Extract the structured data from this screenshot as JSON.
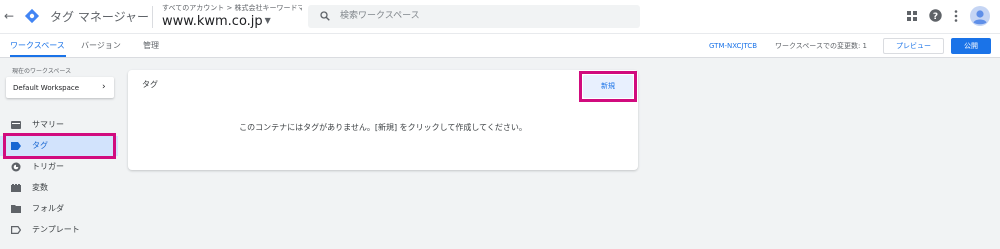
{
  "header": {
    "app_title": "タグ マネージャー",
    "breadcrumb": "すべてのアカウント > 株式会社キーワードマ...",
    "container_name": "www.kwm.co.jp",
    "search_placeholder": "検索ワークスペース"
  },
  "nav": {
    "tabs": [
      {
        "label": "ワークスペース",
        "active": true
      },
      {
        "label": "バージョン",
        "active": false
      },
      {
        "label": "管理",
        "active": false
      }
    ],
    "container_id": "GTM-NXCJTCB",
    "changes_label": "ワークスペースでの変更数: 1",
    "preview_label": "プレビュー",
    "publish_label": "公開"
  },
  "sidebar": {
    "workspace_label": "現在のワークスペース",
    "workspace_name": "Default Workspace",
    "items": [
      {
        "label": "サマリー",
        "icon": "summary-icon",
        "active": false
      },
      {
        "label": "タグ",
        "icon": "tag-icon",
        "active": true
      },
      {
        "label": "トリガー",
        "icon": "trigger-icon",
        "active": false
      },
      {
        "label": "変数",
        "icon": "variables-icon",
        "active": false
      },
      {
        "label": "フォルダ",
        "icon": "folder-icon",
        "active": false
      },
      {
        "label": "テンプレート",
        "icon": "template-icon",
        "active": false
      }
    ]
  },
  "main": {
    "card_title": "タグ",
    "new_button_label": "新規",
    "empty_message": "このコンテナにはタグがありません。[新規] をクリックして作成してください。"
  },
  "colors": {
    "accent": "#1a73e8",
    "highlight": "#d10b7e",
    "active_bg": "#d2e3fc"
  }
}
